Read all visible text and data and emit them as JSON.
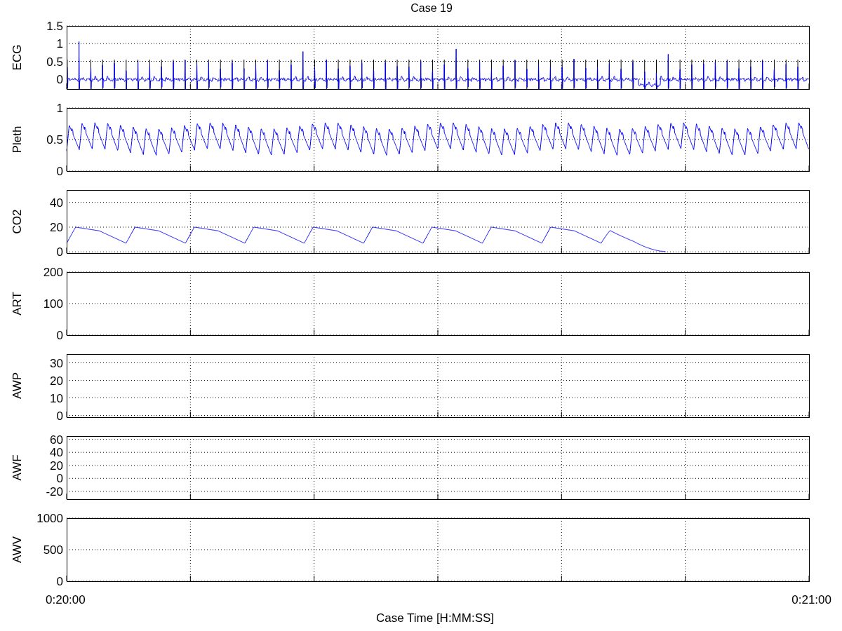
{
  "title": "Case 19",
  "panels": [
    {
      "label": "ECG",
      "kind": "ecg",
      "yticks": [
        "1.5",
        "1",
        "0.5",
        "0"
      ]
    },
    {
      "label": "Pleth",
      "kind": "pleth",
      "yticks": [
        "1",
        "0.5",
        "0"
      ]
    },
    {
      "label": "CO2",
      "kind": "co2",
      "yticks": [
        "40",
        "20",
        "0"
      ]
    },
    {
      "label": "ART",
      "kind": "empty",
      "yticks": [
        "200",
        "100",
        "0"
      ]
    },
    {
      "label": "AWP",
      "kind": "empty",
      "yticks": [
        "30",
        "20",
        "10",
        "0"
      ]
    },
    {
      "label": "AWF",
      "kind": "empty",
      "yticks": [
        "60",
        "40",
        "20",
        "0",
        "-20"
      ]
    },
    {
      "label": "AWV",
      "kind": "empty",
      "yticks": [
        "1000",
        "500",
        "0"
      ]
    }
  ],
  "xticks": [
    "0:20:00",
    "0:21:00"
  ],
  "xlabel": "Case Time [H:MM:SS]"
}
